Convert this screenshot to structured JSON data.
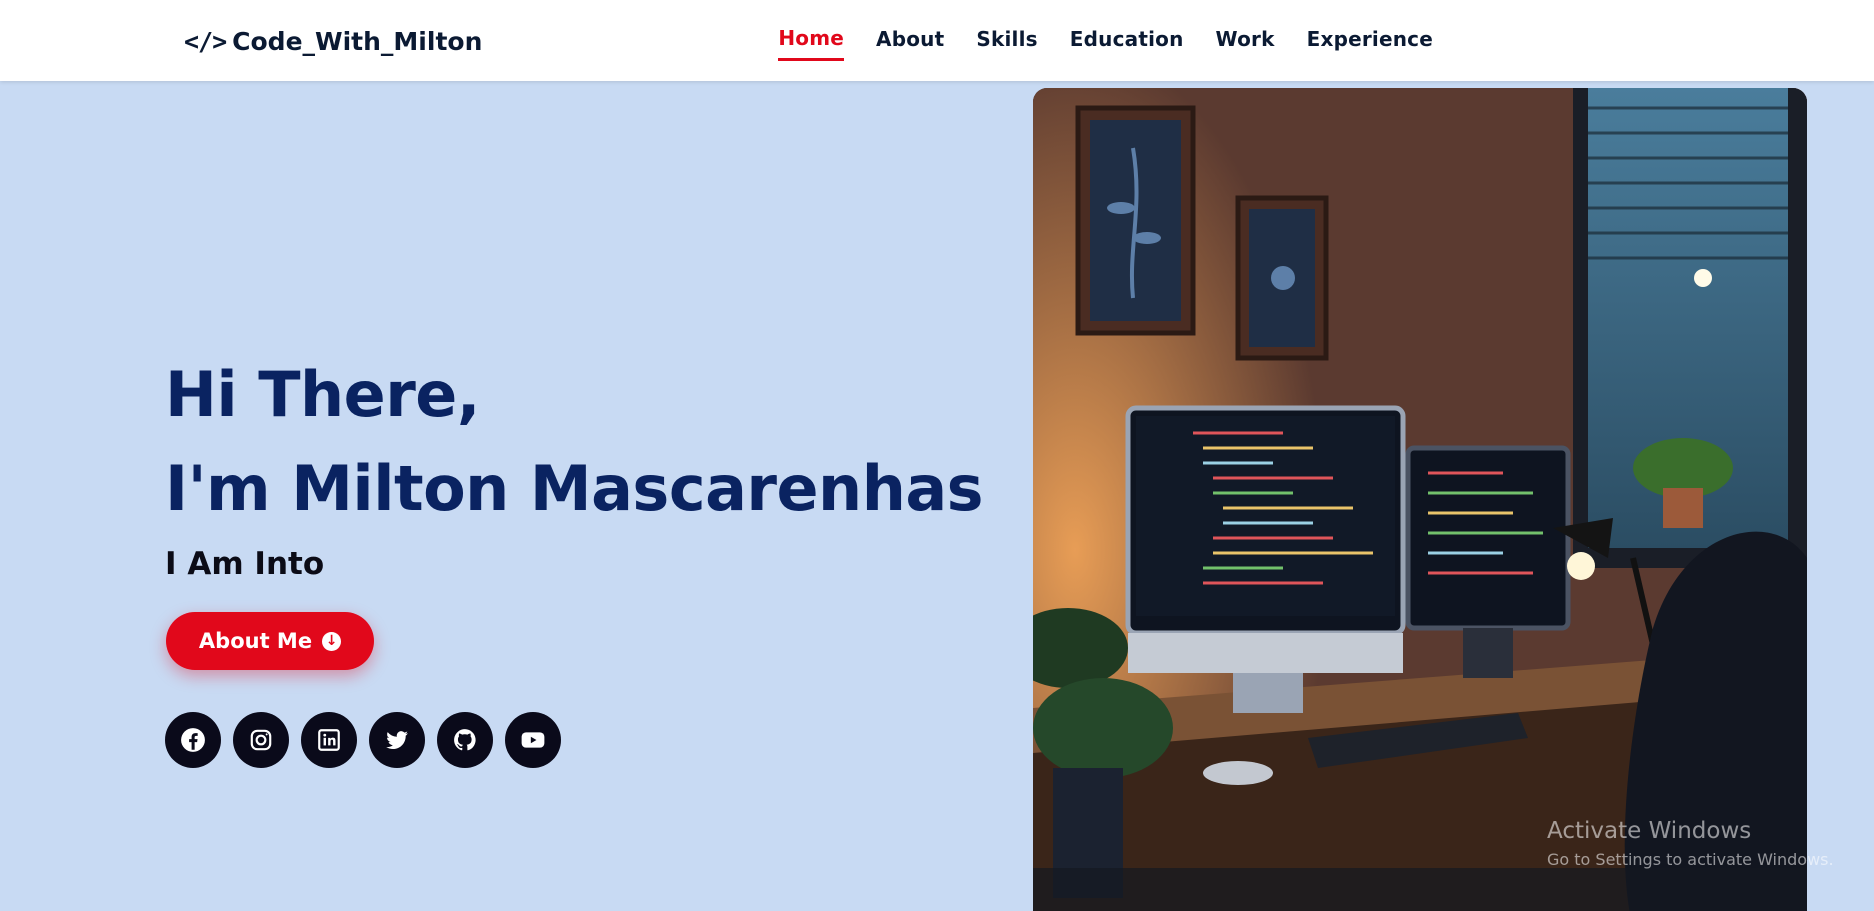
{
  "header": {
    "brand_icon": "</>",
    "brand_name": "Code_With_Milton",
    "nav": [
      {
        "label": "Home",
        "active": true
      },
      {
        "label": "About",
        "active": false
      },
      {
        "label": "Skills",
        "active": false
      },
      {
        "label": "Education",
        "active": false
      },
      {
        "label": "Work",
        "active": false
      },
      {
        "label": "Experience",
        "active": false
      }
    ]
  },
  "hero": {
    "greeting_line1": "Hi There,",
    "greeting_line2": "I'm Milton Mascarenhas",
    "typed_text": "I Am Into",
    "cta_label": "About Me",
    "cta_icon": "arrow-down-circle-icon",
    "socials": [
      {
        "name": "facebook",
        "icon": "facebook-icon"
      },
      {
        "name": "instagram",
        "icon": "instagram-icon"
      },
      {
        "name": "linkedin",
        "icon": "linkedin-icon"
      },
      {
        "name": "twitter",
        "icon": "twitter-icon"
      },
      {
        "name": "github",
        "icon": "github-icon"
      },
      {
        "name": "youtube",
        "icon": "youtube-icon"
      }
    ],
    "image_description_icon": "desk-setup-image"
  },
  "watermark": {
    "title": "Activate Windows",
    "subtitle": "Go to Settings to activate Windows."
  },
  "colors": {
    "background": "#c8daf3",
    "heading": "#0a2361",
    "accent": "#e1081b",
    "nav_text": "#0b1a33",
    "social_bg": "#0a0a1a"
  }
}
